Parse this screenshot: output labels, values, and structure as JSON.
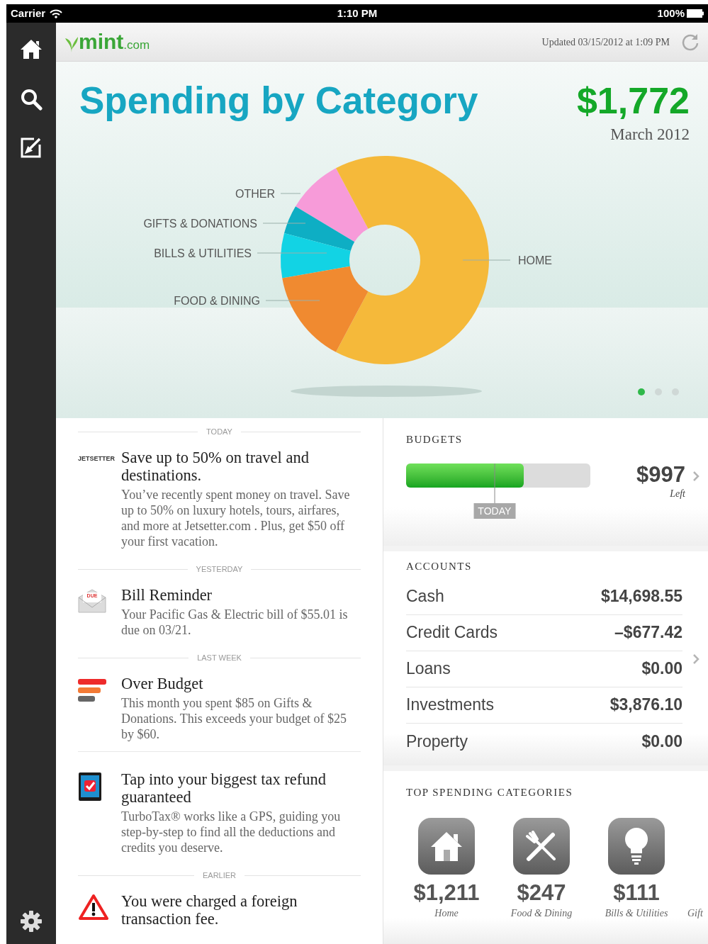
{
  "status_bar": {
    "carrier": "Carrier",
    "time": "1:10 PM",
    "battery": "100%"
  },
  "header": {
    "logo": "mint",
    "logo_suffix": ".com",
    "updated": "Updated 03/15/2012 at 1:09 PM"
  },
  "hero": {
    "title": "Spending by Category",
    "total": "$1,772",
    "period": "March 2012",
    "slices": [
      {
        "label": "OTHER",
        "color": "#f79bd9"
      },
      {
        "label": "GIFTS & DONATIONS",
        "color": "#0eaec4"
      },
      {
        "label": "BILLS & UTILITIES",
        "color": "#12d3e4"
      },
      {
        "label": "HOME",
        "color": "#f5b93a"
      },
      {
        "label": "FOOD & DINING",
        "color": "#f08a30"
      }
    ],
    "pages": [
      {
        "selected": true
      },
      {
        "selected": false
      },
      {
        "selected": false
      }
    ]
  },
  "feed": [
    {
      "kind": "header",
      "label": "TODAY"
    },
    {
      "kind": "item",
      "badge_text": "JETSETTER",
      "title": "Save up to 50% on travel and destinations.",
      "body": "You’ve recently spent money on travel. Save up to 50% on luxury hotels, tours, airfares, and more at Jetsetter.com . Plus, get $50 off your first vacation."
    },
    {
      "kind": "header",
      "label": "YESTERDAY"
    },
    {
      "kind": "item",
      "badge_text": "DUE",
      "title": "Bill Reminder",
      "body": "Your Pacific Gas & Electric bill of $55.01 is due on 03/21."
    },
    {
      "kind": "header",
      "label": "LAST WEEK"
    },
    {
      "kind": "item",
      "title": "Over Budget",
      "body": "This month you spent $85 on Gifts & Donations. This exceeds your budget of $25 by $60."
    },
    {
      "kind": "divider"
    },
    {
      "kind": "item",
      "title": "Tap into your biggest tax refund guaranteed",
      "body": "TurboTax® works like a GPS, guiding you step-by-step to find all the deductions and credits you deserve."
    },
    {
      "kind": "header",
      "label": "EARLIER"
    },
    {
      "kind": "item",
      "title": "You were charged a foreign transaction fee."
    }
  ],
  "budgets": {
    "heading": "BUDGETS",
    "level": 0.64,
    "today_marker": {
      "label": "TODAY",
      "level": 0.48
    },
    "amount": "$997",
    "caption": "Left"
  },
  "accounts": {
    "heading": "ACCOUNTS",
    "rows": [
      {
        "name": "Cash",
        "value": "$14,698.55"
      },
      {
        "name": "Credit Cards",
        "value": "–$677.42"
      },
      {
        "name": "Loans",
        "value": "$0.00"
      },
      {
        "name": "Investments",
        "value": "$3,876.10"
      },
      {
        "name": "Property",
        "value": "$0.00"
      }
    ]
  },
  "top_spending": {
    "heading": "TOP SPENDING CATEGORIES",
    "categories": [
      {
        "amount": "$1,211",
        "label": "Home"
      },
      {
        "amount": "$247",
        "label": "Food & Dining"
      },
      {
        "amount": "$111",
        "label": "Bills & Utilities"
      },
      {
        "label": "Gift"
      }
    ]
  }
}
